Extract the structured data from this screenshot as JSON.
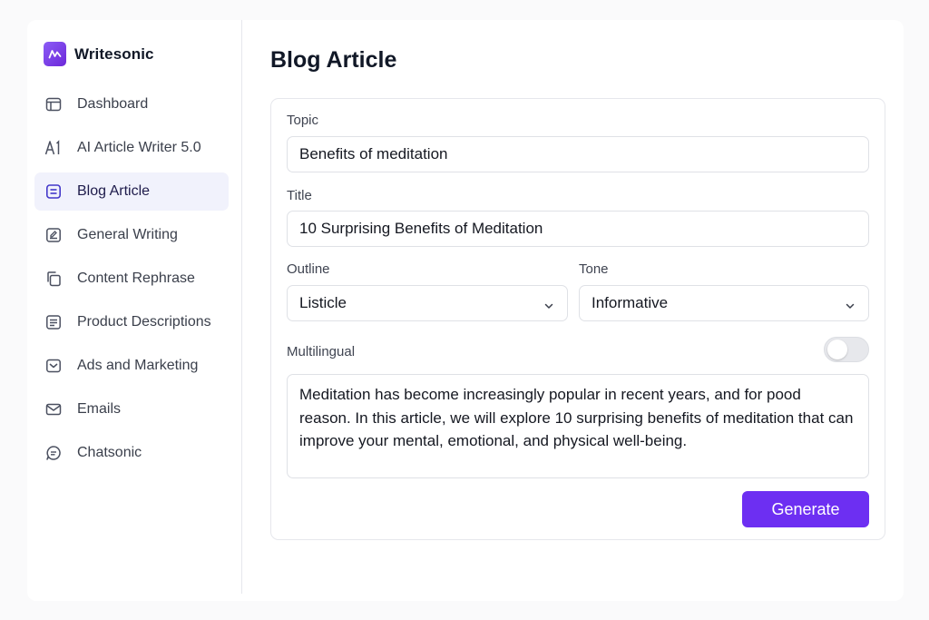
{
  "brand": {
    "name": "Writesonic"
  },
  "sidebar": {
    "items": [
      {
        "label": "Dashboard",
        "icon": "calendar-icon",
        "active": false
      },
      {
        "label": "AI Article Writer 5.0",
        "icon": "ai-text-icon",
        "active": false
      },
      {
        "label": "Blog Article",
        "icon": "blog-doc-icon",
        "active": true
      },
      {
        "label": "General Writing",
        "icon": "writing-icon",
        "active": false
      },
      {
        "label": "Content Rephrase",
        "icon": "copy-icon",
        "active": false
      },
      {
        "label": "Product Descriptions",
        "icon": "description-icon",
        "active": false
      },
      {
        "label": "Ads and Marketing",
        "icon": "ads-icon",
        "active": false
      },
      {
        "label": "Emails",
        "icon": "mail-icon",
        "active": false
      },
      {
        "label": "Chatsonic",
        "icon": "chat-icon",
        "active": false
      }
    ]
  },
  "main": {
    "title": "Blog Article",
    "form": {
      "topic": {
        "label": "Topic",
        "value": "Benefits of meditation"
      },
      "title": {
        "label": "Title",
        "value": "10 Surprising Benefits of Meditation"
      },
      "outline": {
        "label": "Outline",
        "value": "Listicle"
      },
      "tone": {
        "label": "Tone",
        "value": "Informative"
      },
      "multilingual": {
        "label": "Multilingual",
        "enabled": false
      },
      "content": "Meditation has become increasingly popular in recent years, and for pood reason. In this article, we will explore 10 surprising benefits of meditation that can improve your mental, emotional, and physical well-being.",
      "generate_label": "Generate"
    }
  },
  "colors": {
    "accent": "#6d2ff2",
    "active_bg": "#f1f2fc",
    "brand": "#7c3aed"
  }
}
